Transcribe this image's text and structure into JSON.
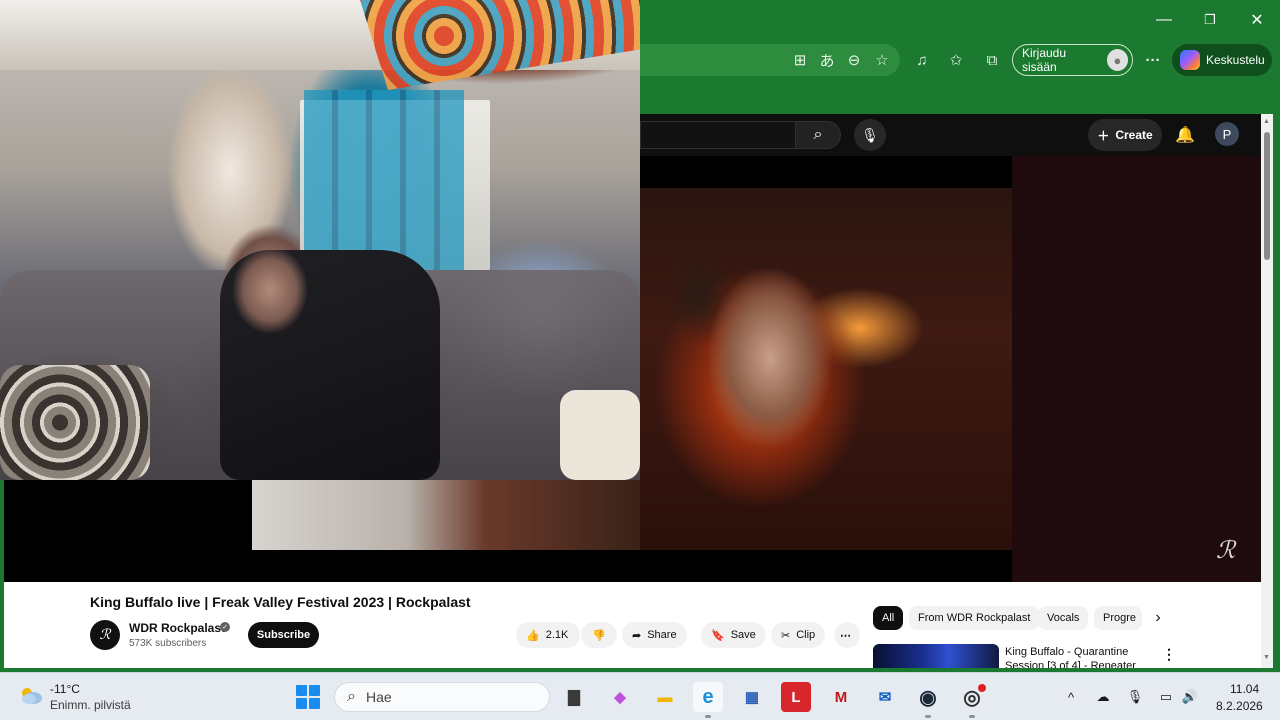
{
  "browser": {
    "window_controls": {
      "minimize": "—",
      "restore": "❐",
      "close": "✕"
    },
    "toolbar": {
      "signin_label": "Kirjaudu sisään",
      "copilot_label": "Keskustelu",
      "more_label": "···"
    },
    "theme_color": "#1c7a30"
  },
  "youtube": {
    "header": {
      "create_label": "Create",
      "profile_initial": "P"
    },
    "video": {
      "title": "King Buffalo live | Freak Valley Festival 2023 | Rockpalast",
      "watermark": "ℛ",
      "channel": {
        "name": "WDR Rockpalast",
        "subscribers": "573K subscribers",
        "avatar_glyph": "ℛ"
      },
      "subscribe_label": "Subscribe",
      "like_count": "2.1K",
      "share_label": "Share",
      "save_label": "Save",
      "clip_label": "Clip"
    },
    "chips": [
      "All",
      "From WDR Rockpalast",
      "Vocals",
      "Progre"
    ],
    "recommendation": {
      "title": "King Buffalo - Quarantine Session [3 of 4] - Repeater"
    }
  },
  "taskbar": {
    "weather": {
      "temp": "-11°C",
      "desc": "Enimm. pilvistä"
    },
    "search_placeholder": "Hae",
    "apps": [
      {
        "name": "task-view",
        "glyph": "▇",
        "color": "#3a3a3a"
      },
      {
        "name": "copilot",
        "glyph": "◆",
        "color": "#c050e0"
      },
      {
        "name": "file-explorer",
        "glyph": "▬",
        "color": "#f2b705"
      },
      {
        "name": "edge",
        "glyph": "e",
        "color": "#1e8fd8"
      },
      {
        "name": "store",
        "glyph": "▦",
        "color": "#2a5fb8"
      },
      {
        "name": "lastpass",
        "glyph": "L",
        "color": "#d7262c"
      },
      {
        "name": "mcafee",
        "glyph": "M",
        "color": "#c01818"
      },
      {
        "name": "outlook",
        "glyph": "✉",
        "color": "#1060c0"
      },
      {
        "name": "steam",
        "glyph": "◉",
        "color": "#1b2838"
      },
      {
        "name": "obs",
        "glyph": "◎",
        "color": "#302e31"
      }
    ],
    "clock": {
      "time": "11.04",
      "date": "8.2.2026"
    }
  }
}
